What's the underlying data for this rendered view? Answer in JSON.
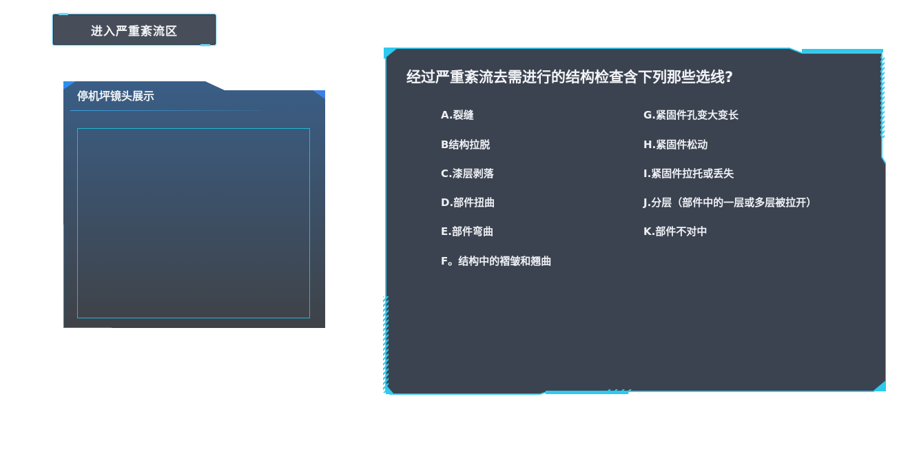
{
  "enter_button": {
    "label": "进入严重紊流区"
  },
  "camera_panel": {
    "title": "停机坪镜头展示"
  },
  "question": {
    "title": "经过严重紊流去需进行的结构检查含下列那些选线?",
    "left_options": [
      "A.裂缝",
      "B结构拉脱",
      "C.漆层剥落",
      "D.部件扭曲",
      "E.部件弯曲",
      "F。结构中的褶皱和翘曲"
    ],
    "right_options": [
      "G.紧固件孔变大变长",
      "H.紧固件松动",
      "I.紧固件拉托或丢失",
      "J.分层（部件中的一层或多层被拉开）",
      "K.部件不对中"
    ]
  },
  "colors": {
    "panel_fill": "#3c4350",
    "accent_cyan": "#2ec9ee",
    "camera_top": "#3a5e86",
    "camera_bottom": "#3f4247"
  }
}
